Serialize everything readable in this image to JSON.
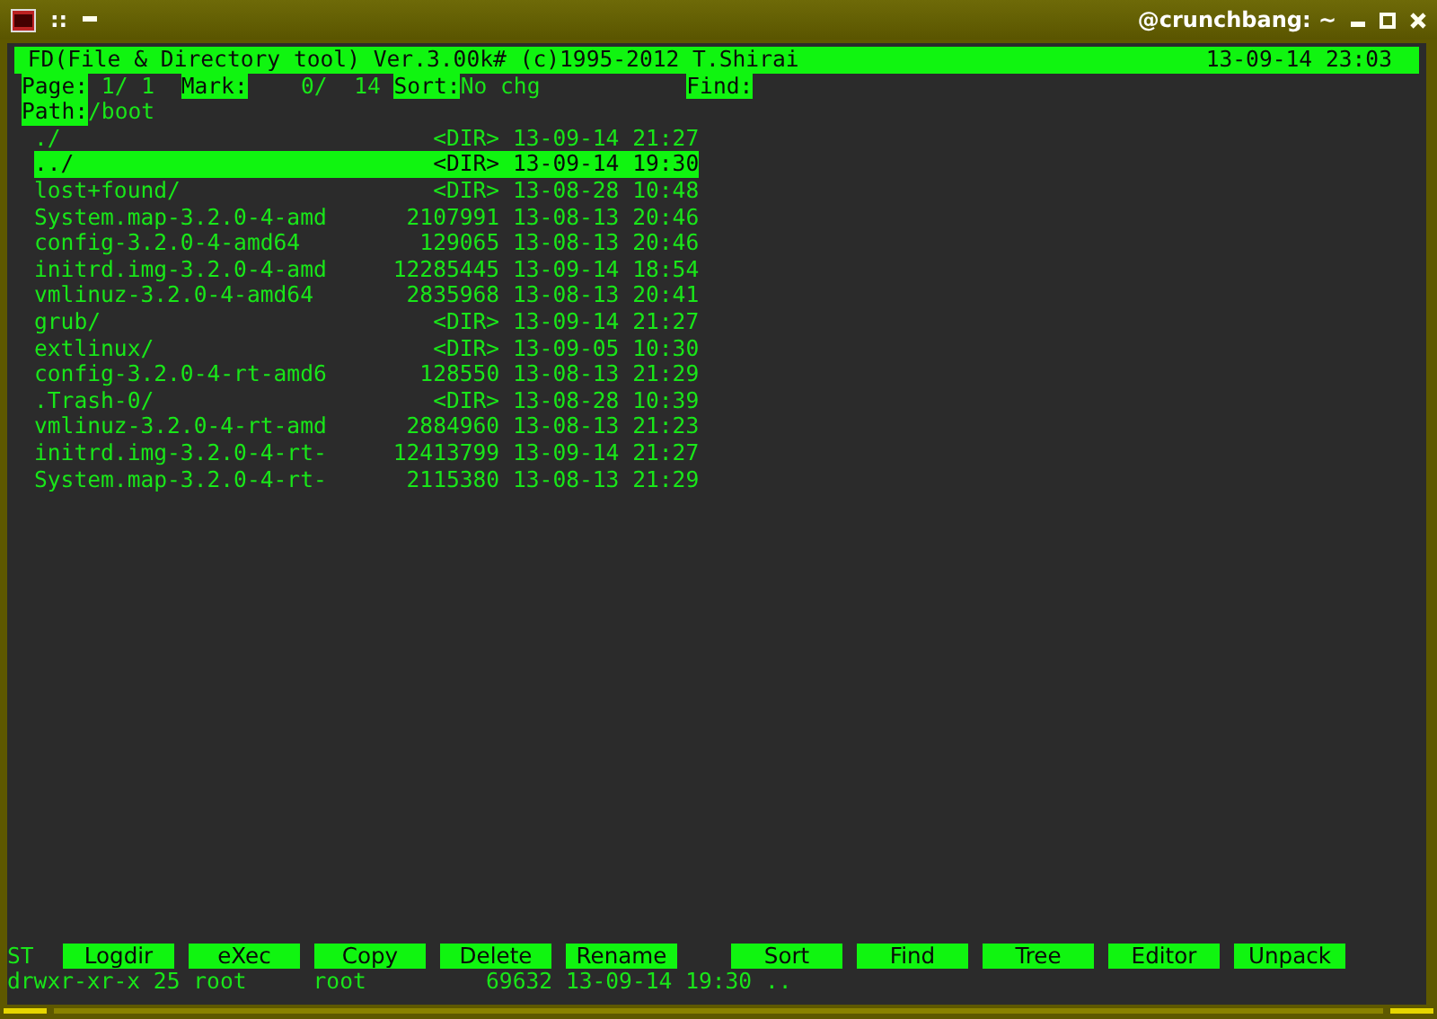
{
  "window": {
    "title": "@crunchbang: ~",
    "menu_glyph": "::"
  },
  "header": {
    "title": "FD(File & Directory tool) Ver.3.00k# (c)1995-2012 T.Shirai",
    "datetime": "13-09-14 23:03"
  },
  "info_fields": [
    {
      "label": "Page:",
      "value": "1/ 1"
    },
    {
      "label": "Mark:",
      "value": "0/  14"
    },
    {
      "label": "Sort:",
      "value": "No chg"
    },
    {
      "label": "Find:"
    }
  ],
  "path": {
    "label": "Path:",
    "value": "/boot"
  },
  "files": [
    {
      "name": "./",
      "size": "<DIR>",
      "date": "13-09-14",
      "time": "21:27",
      "selected": false
    },
    {
      "name": "../",
      "size": "<DIR>",
      "date": "13-09-14",
      "time": "19:30",
      "selected": true
    },
    {
      "name": "lost+found/",
      "size": "<DIR>",
      "date": "13-08-28",
      "time": "10:48",
      "selected": false
    },
    {
      "name": "System.map-3.2.0-4-amd",
      "size": "2107991",
      "date": "13-08-13",
      "time": "20:46",
      "selected": false
    },
    {
      "name": "config-3.2.0-4-amd64",
      "size": "129065",
      "date": "13-08-13",
      "time": "20:46",
      "selected": false
    },
    {
      "name": "initrd.img-3.2.0-4-amd",
      "size": "12285445",
      "date": "13-09-14",
      "time": "18:54",
      "selected": false
    },
    {
      "name": "vmlinuz-3.2.0-4-amd64",
      "size": "2835968",
      "date": "13-08-13",
      "time": "20:41",
      "selected": false
    },
    {
      "name": "grub/",
      "size": "<DIR>",
      "date": "13-09-14",
      "time": "21:27",
      "selected": false
    },
    {
      "name": "extlinux/",
      "size": "<DIR>",
      "date": "13-09-05",
      "time": "10:30",
      "selected": false
    },
    {
      "name": "config-3.2.0-4-rt-amd6",
      "size": "128550",
      "date": "13-08-13",
      "time": "21:29",
      "selected": false
    },
    {
      "name": ".Trash-0/",
      "size": "<DIR>",
      "date": "13-08-28",
      "time": "10:39",
      "selected": false
    },
    {
      "name": "vmlinuz-3.2.0-4-rt-amd",
      "size": "2884960",
      "date": "13-08-13",
      "time": "21:23",
      "selected": false
    },
    {
      "name": "initrd.img-3.2.0-4-rt-",
      "size": "12413799",
      "date": "13-09-14",
      "time": "21:27",
      "selected": false
    },
    {
      "name": "System.map-3.2.0-4-rt-",
      "size": "2115380",
      "date": "13-08-13",
      "time": "21:29",
      "selected": false
    }
  ],
  "function_keys": {
    "prefix": "ST",
    "groups": [
      [
        "Logdir",
        "eXec",
        "Copy",
        "Delete",
        "Rename"
      ],
      [
        "Sort",
        "Find",
        "Tree",
        "Editor",
        "Unpack"
      ]
    ]
  },
  "status_line": "drwxr-xr-x 25 root     root         69632 13-09-14 19:30 .."
}
